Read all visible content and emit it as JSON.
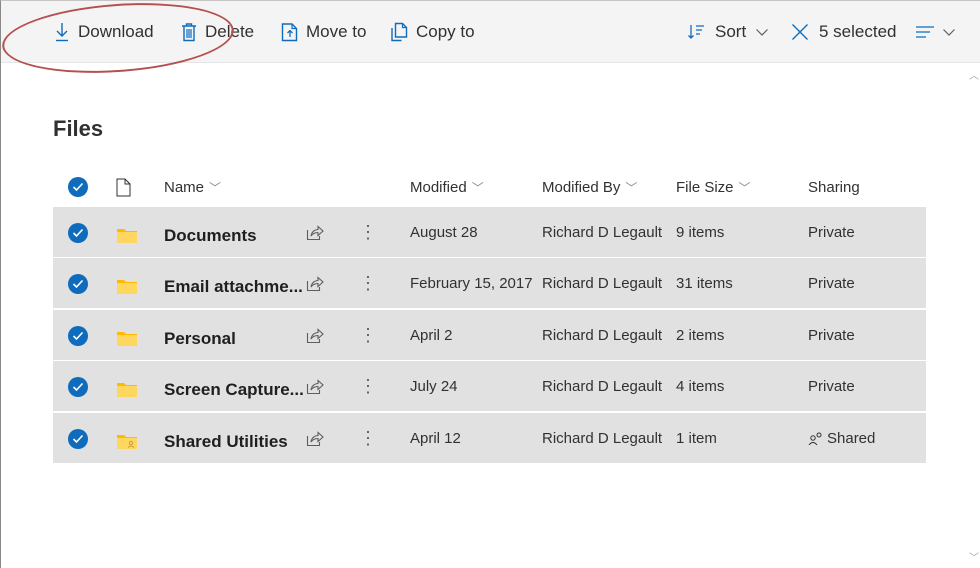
{
  "toolbar": {
    "download": "Download",
    "delete": "Delete",
    "move_to": "Move to",
    "copy_to": "Copy to",
    "sort": "Sort",
    "selected": "5 selected"
  },
  "page": {
    "title": "Files"
  },
  "columns": {
    "name": "Name",
    "modified": "Modified",
    "modified_by": "Modified By",
    "file_size": "File Size",
    "sharing": "Sharing"
  },
  "rows": [
    {
      "name": "Documents",
      "modified": "August 28",
      "modified_by": "Richard D Legault",
      "size": "9 items",
      "sharing": "Private",
      "icon": "folder-icon"
    },
    {
      "name": "Email attachme...",
      "modified": "February 15, 2017",
      "modified_by": "Richard D Legault",
      "size": "31 items",
      "sharing": "Private",
      "icon": "folder-icon"
    },
    {
      "name": "Personal",
      "modified": "April 2",
      "modified_by": "Richard D Legault",
      "size": "2 items",
      "sharing": "Private",
      "icon": "folder-icon"
    },
    {
      "name": "Screen Capture...",
      "modified": "July 24",
      "modified_by": "Richard D Legault",
      "size": "4 items",
      "sharing": "Private",
      "icon": "folder-icon"
    },
    {
      "name": "Shared Utilities",
      "modified": "April 12",
      "modified_by": "Richard D Legault",
      "size": "1 item",
      "sharing": "Shared",
      "icon": "shared-folder-icon"
    }
  ],
  "colors": {
    "accent": "#0f6cbd",
    "selected_row": "#e1e1e1",
    "toolbar_bg": "#f4f4f4",
    "folder": "#ffc83d",
    "annotation": "#b5504f"
  }
}
